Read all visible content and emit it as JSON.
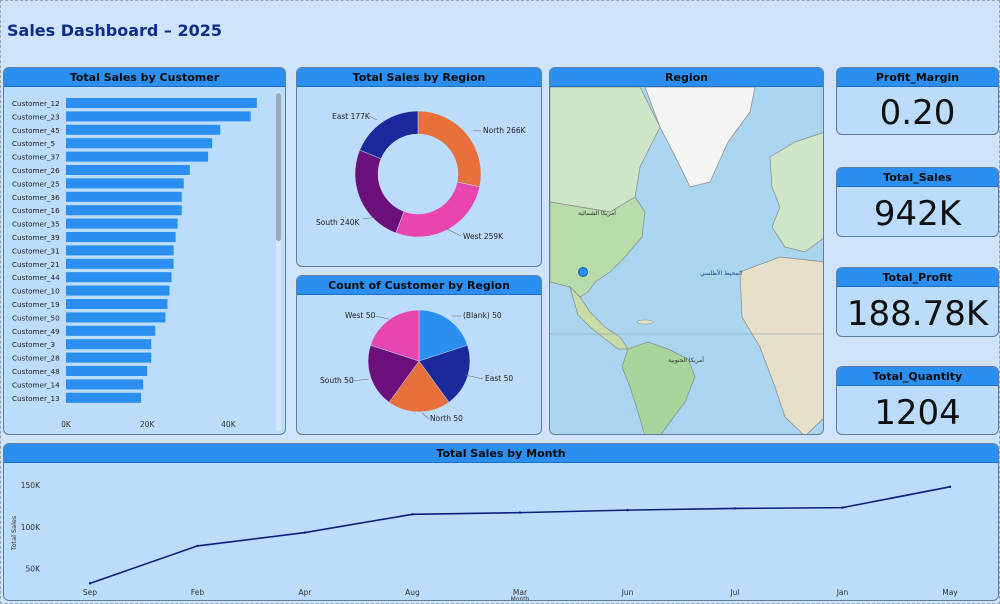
{
  "dashboard": {
    "title": "Sales Dashboard – 2025"
  },
  "customers_panel": {
    "title": "Total Sales by Customer",
    "axis_ticks": [
      "0K",
      "20K",
      "40K"
    ],
    "colors": {
      "bar": "#2a8ff0"
    }
  },
  "region_donut_panel": {
    "title": "Total Sales by Region",
    "labels": [
      "North 266K",
      "West 259K",
      "South 240K",
      "East 177K"
    ]
  },
  "customer_pie_panel": {
    "title": "Count of Customer by Region",
    "labels": [
      "(Blank) 50",
      "East 50",
      "North 50",
      "South 50",
      "West 50"
    ]
  },
  "map_panel": {
    "title": "Region",
    "label_north_america": "أمريكا الشمالية",
    "label_atlantic": "المحيط الأطلسي",
    "label_south_america": "أمريكا الجنوبية"
  },
  "kpis": [
    {
      "title": "Profit_Margin",
      "value": "0.20"
    },
    {
      "title": "Total_Sales",
      "value": "942K"
    },
    {
      "title": "Total_Profit",
      "value": "188.78K"
    },
    {
      "title": "Total_Quantity",
      "value": "1204"
    }
  ],
  "month_panel": {
    "title": "Total Sales by Month"
  },
  "chart_data": [
    {
      "type": "bar",
      "title": "Total Sales by Customer",
      "orientation": "horizontal",
      "categories": [
        "Customer_12",
        "Customer_23",
        "Customer_45",
        "Customer_5",
        "Customer_37",
        "Customer_26",
        "Customer_25",
        "Customer_36",
        "Customer_16",
        "Customer_35",
        "Customer_39",
        "Customer_31",
        "Customer_21",
        "Customer_44",
        "Customer_10",
        "Customer_19",
        "Customer_50",
        "Customer_49",
        "Customer_3",
        "Customer_28",
        "Customer_48",
        "Customer_14",
        "Customer_13"
      ],
      "values": [
        47000,
        45500,
        38000,
        36000,
        35000,
        30500,
        29000,
        28500,
        28500,
        27500,
        27000,
        26500,
        26500,
        26000,
        25500,
        25000,
        24500,
        22000,
        21000,
        21000,
        20000,
        19000,
        18500
      ],
      "xlim": [
        0,
        50000
      ],
      "xticks": [
        "0K",
        "20K",
        "40K"
      ]
    },
    {
      "type": "pie",
      "variant": "donut",
      "title": "Total Sales by Region",
      "labels": [
        "North",
        "West",
        "South",
        "East"
      ],
      "values": [
        266,
        259,
        240,
        177
      ],
      "colors": [
        "#e8703a",
        "#e845b0",
        "#6b0f7a",
        "#1a2a9c"
      ]
    },
    {
      "type": "pie",
      "title": "Count of Customer by Region",
      "labels": [
        "(Blank)",
        "East",
        "North",
        "South",
        "West"
      ],
      "values": [
        50,
        50,
        50,
        50,
        50
      ],
      "colors": [
        "#2a8ff0",
        "#1a2a9c",
        "#e8703a",
        "#6b0f7a",
        "#e845b0"
      ]
    },
    {
      "type": "line",
      "title": "Total Sales by Month",
      "xlabel": "Month",
      "ylabel": "Total Sales",
      "categories": [
        "Sep",
        "Feb",
        "Apr",
        "Aug",
        "Mar",
        "Jun",
        "Jul",
        "Jan",
        "May"
      ],
      "values": [
        32000,
        77000,
        93000,
        115000,
        117000,
        120000,
        122000,
        123000,
        148000
      ],
      "yticks": [
        "50K",
        "100K",
        "150K"
      ],
      "ylim": [
        30000,
        155000
      ],
      "colors": {
        "line": "#0c1f7a"
      }
    }
  ]
}
